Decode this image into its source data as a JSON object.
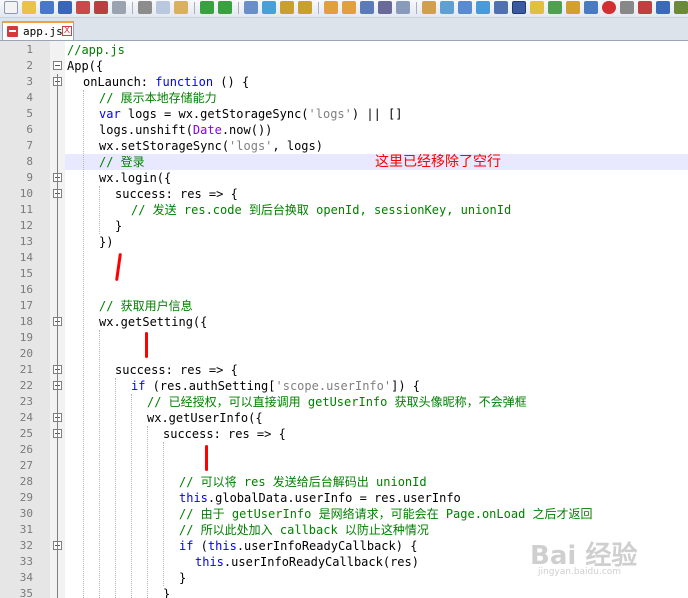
{
  "tab": {
    "label": "app.js",
    "close_label": "X"
  },
  "annotation": "这里已经移除了空行",
  "watermark": {
    "logo": "Bai 经验",
    "url": "jingyan.baidu.com"
  },
  "lines": [
    {
      "n": "1",
      "fold": false,
      "indent": 0,
      "tokens": [
        {
          "t": "//app.js",
          "c": "cm"
        }
      ]
    },
    {
      "n": "2",
      "fold": true,
      "indent": 0,
      "tokens": [
        {
          "t": "App({",
          "c": ""
        }
      ]
    },
    {
      "n": "3",
      "fold": true,
      "indent": 1,
      "tokens": [
        {
          "t": "onLaunch: ",
          "c": ""
        },
        {
          "t": "function",
          "c": "kw"
        },
        {
          "t": " () {",
          "c": ""
        }
      ]
    },
    {
      "n": "4",
      "fold": false,
      "indent": 2,
      "tokens": [
        {
          "t": "// 展示本地存储能力",
          "c": "cm"
        }
      ]
    },
    {
      "n": "5",
      "fold": false,
      "indent": 2,
      "tokens": [
        {
          "t": "var",
          "c": "kw"
        },
        {
          "t": " logs = wx.getStorageSync(",
          "c": ""
        },
        {
          "t": "'logs'",
          "c": "st"
        },
        {
          "t": ") || []",
          "c": ""
        }
      ]
    },
    {
      "n": "6",
      "fold": false,
      "indent": 2,
      "tokens": [
        {
          "t": "logs.unshift(",
          "c": ""
        },
        {
          "t": "Date",
          "c": "fn"
        },
        {
          "t": ".now())",
          "c": ""
        }
      ]
    },
    {
      "n": "7",
      "fold": false,
      "indent": 2,
      "tokens": [
        {
          "t": "wx.setStorageSync(",
          "c": ""
        },
        {
          "t": "'logs'",
          "c": "st"
        },
        {
          "t": ", logs)",
          "c": ""
        }
      ]
    },
    {
      "n": "8",
      "fold": false,
      "indent": 2,
      "tokens": [
        {
          "t": "// 登录",
          "c": "cm"
        }
      ]
    },
    {
      "n": "9",
      "fold": true,
      "indent": 2,
      "tokens": [
        {
          "t": "wx.login({",
          "c": ""
        }
      ]
    },
    {
      "n": "10",
      "fold": true,
      "indent": 3,
      "tokens": [
        {
          "t": "success: res => {",
          "c": ""
        }
      ]
    },
    {
      "n": "11",
      "fold": false,
      "indent": 4,
      "tokens": [
        {
          "t": "// 发送 res.code 到后台换取 openId, sessionKey, unionId",
          "c": "cm"
        }
      ]
    },
    {
      "n": "12",
      "fold": false,
      "indent": 3,
      "tokens": [
        {
          "t": "}",
          "c": ""
        }
      ]
    },
    {
      "n": "13",
      "fold": false,
      "indent": 2,
      "tokens": [
        {
          "t": "})",
          "c": ""
        }
      ]
    },
    {
      "n": "14",
      "fold": false,
      "indent": 0,
      "tokens": []
    },
    {
      "n": "15",
      "fold": false,
      "indent": 0,
      "tokens": []
    },
    {
      "n": "16",
      "fold": false,
      "indent": 0,
      "tokens": []
    },
    {
      "n": "17",
      "fold": false,
      "indent": 2,
      "tokens": [
        {
          "t": "// 获取用户信息",
          "c": "cm"
        }
      ]
    },
    {
      "n": "18",
      "fold": true,
      "indent": 2,
      "tokens": [
        {
          "t": "wx.getSetting({",
          "c": ""
        }
      ]
    },
    {
      "n": "19",
      "fold": false,
      "indent": 0,
      "tokens": []
    },
    {
      "n": "20",
      "fold": false,
      "indent": 0,
      "tokens": []
    },
    {
      "n": "21",
      "fold": true,
      "indent": 3,
      "tokens": [
        {
          "t": "success: res => {",
          "c": ""
        }
      ]
    },
    {
      "n": "22",
      "fold": true,
      "indent": 4,
      "tokens": [
        {
          "t": "if",
          "c": "kw"
        },
        {
          "t": " (res.authSetting[",
          "c": ""
        },
        {
          "t": "'scope.userInfo'",
          "c": "st"
        },
        {
          "t": "]) {",
          "c": ""
        }
      ]
    },
    {
      "n": "23",
      "fold": false,
      "indent": 5,
      "tokens": [
        {
          "t": "// 已经授权，可以直接调用 getUserInfo 获取头像昵称，不会弹框",
          "c": "cm"
        }
      ]
    },
    {
      "n": "24",
      "fold": true,
      "indent": 5,
      "tokens": [
        {
          "t": "wx.getUserInfo({",
          "c": ""
        }
      ]
    },
    {
      "n": "25",
      "fold": true,
      "indent": 6,
      "tokens": [
        {
          "t": "success: res => {",
          "c": ""
        }
      ]
    },
    {
      "n": "26",
      "fold": false,
      "indent": 0,
      "tokens": []
    },
    {
      "n": "27",
      "fold": false,
      "indent": 0,
      "tokens": []
    },
    {
      "n": "28",
      "fold": false,
      "indent": 7,
      "tokens": [
        {
          "t": "// 可以将 res 发送给后台解码出 unionId",
          "c": "cm"
        }
      ]
    },
    {
      "n": "29",
      "fold": false,
      "indent": 7,
      "tokens": [
        {
          "t": "this",
          "c": "kw"
        },
        {
          "t": ".globalData.userInfo = res.userInfo",
          "c": ""
        }
      ]
    },
    {
      "n": "30",
      "fold": false,
      "indent": 7,
      "tokens": [
        {
          "t": "// 由于 getUserInfo 是网络请求，可能会在 Page.onLoad 之后才返回",
          "c": "cm"
        }
      ]
    },
    {
      "n": "31",
      "fold": false,
      "indent": 7,
      "tokens": [
        {
          "t": "// 所以此处加入 callback 以防止这种情况",
          "c": "cm"
        }
      ]
    },
    {
      "n": "32",
      "fold": true,
      "indent": 7,
      "tokens": [
        {
          "t": "if",
          "c": "kw"
        },
        {
          "t": " (",
          "c": ""
        },
        {
          "t": "this",
          "c": "kw"
        },
        {
          "t": ".userInfoReadyCallback) {",
          "c": ""
        }
      ]
    },
    {
      "n": "33",
      "fold": false,
      "indent": 8,
      "tokens": [
        {
          "t": "this",
          "c": "kw"
        },
        {
          "t": ".userInfoReadyCallback(res)",
          "c": ""
        }
      ]
    },
    {
      "n": "34",
      "fold": false,
      "indent": 7,
      "tokens": [
        {
          "t": "}",
          "c": ""
        }
      ]
    },
    {
      "n": "35",
      "fold": false,
      "indent": 6,
      "tokens": [
        {
          "t": "}",
          "c": ""
        }
      ]
    }
  ]
}
